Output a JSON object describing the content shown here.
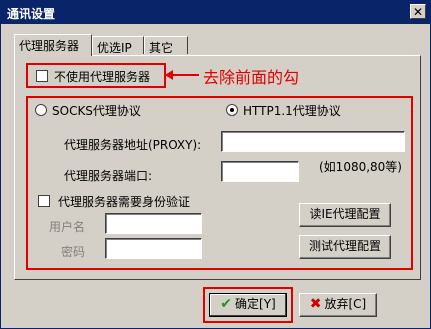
{
  "window": {
    "title": "通讯设置"
  },
  "tabs": [
    {
      "label": "代理服务器",
      "active": true
    },
    {
      "label": "优选IP",
      "active": false
    },
    {
      "label": "其它",
      "active": false
    }
  ],
  "no_proxy": {
    "label": "不使用代理服务器",
    "checked": false
  },
  "annotation": {
    "text": "去除前面的勾",
    "color": "#e00000"
  },
  "protocol": {
    "socks_label": "SOCKS代理协议",
    "http_label": "HTTP1.1代理协议",
    "selected": "http"
  },
  "proxy_address": {
    "label": "代理服务器地址(PROXY):",
    "value": ""
  },
  "proxy_port": {
    "label": "代理服务器端口:",
    "value": "",
    "hint": "(如1080,80等)"
  },
  "auth": {
    "label": "代理服务器需要身份验证",
    "checked": false
  },
  "username": {
    "label": "用户名",
    "value": ""
  },
  "password": {
    "label": "密码",
    "value": ""
  },
  "buttons": {
    "read_ie": "读IE代理配置",
    "test": "测试代理配置",
    "ok": "确定[Y]",
    "cancel": "放弃[C]"
  },
  "close_icon": "close-icon",
  "colors": {
    "highlight": "#e00000",
    "title_bar": "#0a246a",
    "face": "#d4d0c8"
  }
}
